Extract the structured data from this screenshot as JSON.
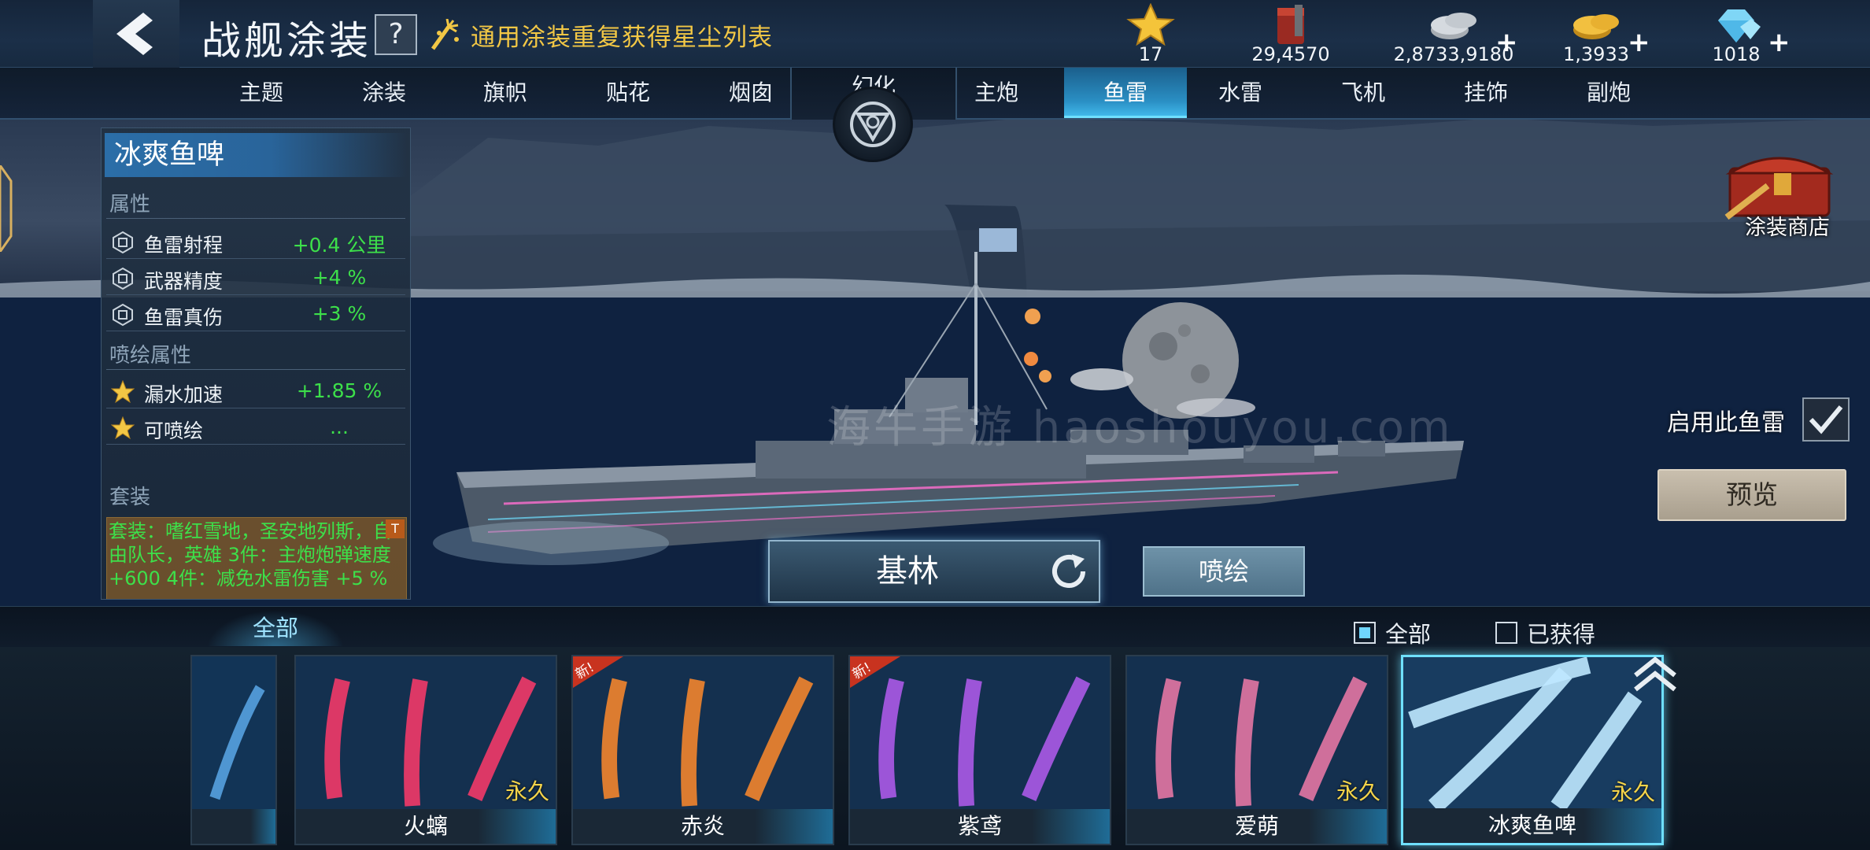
{
  "header": {
    "title": "战舰涂装",
    "help_label": "?",
    "stardust_link": "通用涂装重复获得星尘列表"
  },
  "resources": [
    {
      "icon": "star-icon",
      "value": "17",
      "has_plus": false
    },
    {
      "icon": "paint-bucket-icon",
      "value": "29,4570",
      "has_plus": false
    },
    {
      "icon": "silver-coins-icon",
      "value": "2,8733,9180",
      "has_plus": true
    },
    {
      "icon": "gold-coins-icon",
      "value": "1,3933",
      "has_plus": true
    },
    {
      "icon": "diamond-icon",
      "value": "1018",
      "has_plus": true
    }
  ],
  "tabs": {
    "left": [
      "主题",
      "涂装",
      "旗帜",
      "贴花",
      "烟囱"
    ],
    "illusion": "幻化",
    "right": [
      "主炮",
      "鱼雷",
      "水雷",
      "飞机",
      "挂饰",
      "副炮"
    ],
    "active": "鱼雷"
  },
  "info_panel": {
    "skin_name": "冰爽鱼啤",
    "attributes_heading": "属性",
    "attributes": [
      {
        "icon": "torpedo-attr-icon",
        "name": "鱼雷射程",
        "value": "+0.4 公里"
      },
      {
        "icon": "torpedo-attr-icon",
        "name": "武器精度",
        "value": "+4 %"
      },
      {
        "icon": "torpedo-attr-icon",
        "name": "鱼雷真伤",
        "value": "+3 %"
      }
    ],
    "spray_heading": "喷绘属性",
    "spray_attributes": [
      {
        "icon": "gold-star-icon",
        "name": "漏水加速",
        "value": "+1.85 %"
      },
      {
        "icon": "gold-star-icon",
        "name": "可喷绘",
        "value": "..."
      }
    ],
    "set_heading": "套装",
    "set_text": "套装：嗜红雪地，圣安地列斯，自由队长，英雄 3件：主炮炮弹速度 +600 4件：减免水雷伤害 +5 %"
  },
  "right_side": {
    "shop_label": "涂装商店",
    "enable_label": "启用此鱼雷",
    "enable_checked": true,
    "preview_label": "预览"
  },
  "ship": {
    "name": "基林",
    "spray_button": "喷绘"
  },
  "filter": {
    "tab_label": "全部",
    "all_label": "全部",
    "all_checked": true,
    "owned_label": "已获得",
    "owned_checked": false
  },
  "cards": [
    {
      "name": "",
      "permanent": "",
      "is_new": false,
      "color": "#5aa8e8",
      "selected": false
    },
    {
      "name": "火螭",
      "permanent": "永久",
      "is_new": false,
      "color": "#ff3a6a",
      "selected": false
    },
    {
      "name": "赤炎",
      "permanent": "",
      "is_new": true,
      "color": "#ff8a2a",
      "selected": false
    },
    {
      "name": "紫鸢",
      "permanent": "",
      "is_new": true,
      "color": "#b45cf0",
      "selected": false
    },
    {
      "name": "爱萌",
      "permanent": "永久",
      "is_new": false,
      "color": "#f07aa8",
      "selected": false
    },
    {
      "name": "冰爽鱼啤",
      "permanent": "永久",
      "is_new": false,
      "color": "#bfe8ff",
      "selected": true
    }
  ],
  "new_badge": "新!",
  "watermark": "海牛手游 haoshouyou.com"
}
